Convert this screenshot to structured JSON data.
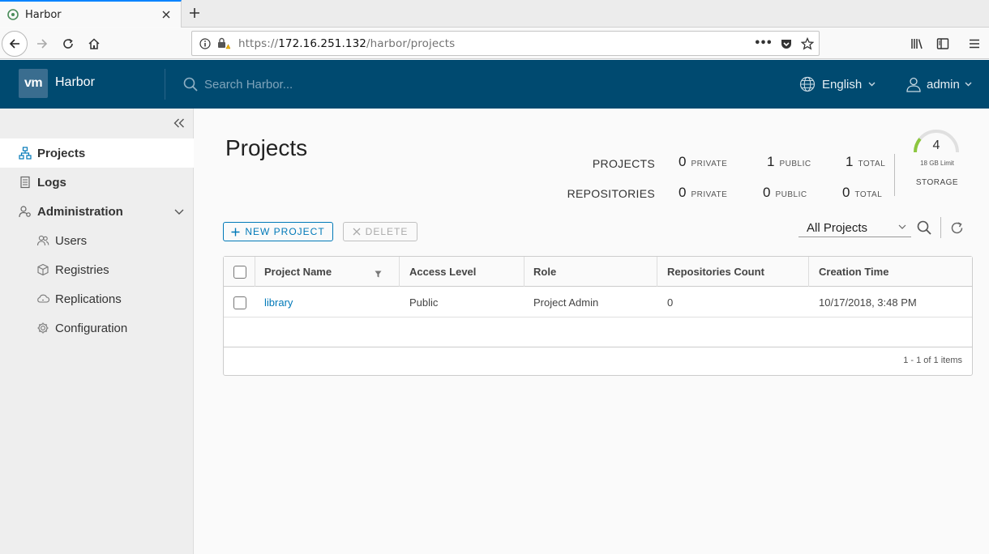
{
  "browser": {
    "tab_title": "Harbor",
    "url_scheme": "https://",
    "url_host": "172.16.251.132",
    "url_path": "/harbor/projects",
    "url_more": "•••"
  },
  "header": {
    "logo_text": "vm",
    "brand": "Harbor",
    "search_placeholder": "Search Harbor...",
    "language": "English",
    "user": "admin"
  },
  "sidebar": {
    "items": [
      {
        "label": "Projects",
        "icon": "projects-icon"
      },
      {
        "label": "Logs",
        "icon": "logs-icon"
      },
      {
        "label": "Administration",
        "icon": "administration-icon"
      },
      {
        "label": "Users",
        "icon": "users-icon"
      },
      {
        "label": "Registries",
        "icon": "registries-icon"
      },
      {
        "label": "Replications",
        "icon": "replications-icon"
      },
      {
        "label": "Configuration",
        "icon": "configuration-icon"
      }
    ]
  },
  "main": {
    "title": "Projects",
    "summary": {
      "projects_label": "PROJECTS",
      "repositories_label": "REPOSITORIES",
      "projects": {
        "private": "0",
        "public": "1",
        "total": "1"
      },
      "repositories": {
        "private": "0",
        "public": "0",
        "total": "0"
      },
      "private_unit": "PRIVATE",
      "public_unit": "PUBLIC",
      "total_unit": "TOTAL",
      "storage_value": "4",
      "storage_limit": "18 GB Limit",
      "storage_label": "STORAGE",
      "storage_fraction": 0.22
    },
    "new_project_label": "NEW PROJECT",
    "delete_label": "DELETE",
    "filter_value": "All Projects",
    "table": {
      "headers": [
        "Project Name",
        "Access Level",
        "Role",
        "Repositories Count",
        "Creation Time"
      ],
      "rows": [
        {
          "name": "library",
          "access": "Public",
          "role": "Project Admin",
          "repos": "0",
          "created": "10/17/2018, 3:48 PM"
        }
      ],
      "footer": "1 - 1 of 1 items"
    }
  }
}
